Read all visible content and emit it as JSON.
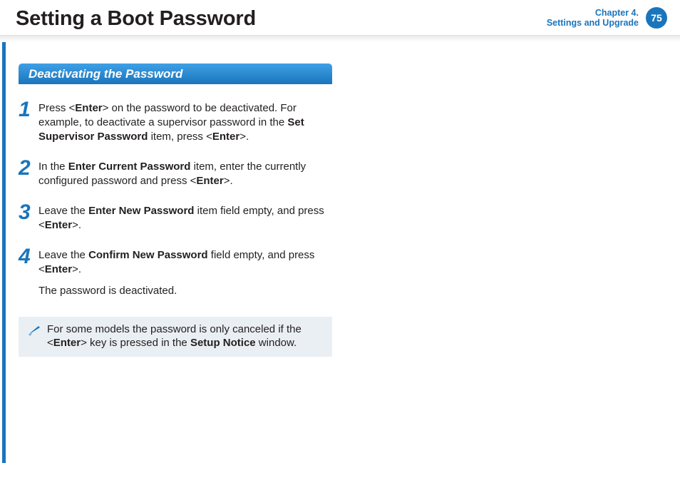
{
  "header": {
    "title": "Setting a Boot Password",
    "chapter_line1": "Chapter 4.",
    "chapter_line2": "Settings and Upgrade",
    "page_number": "75"
  },
  "section": {
    "heading": "Deactivating the Password"
  },
  "steps": [
    {
      "num": "1",
      "html": "Press <<b>Enter</b>> on the password to be deactivated. For example, to deactivate a supervisor password in the <b>Set Supervisor Password</b> item, press <<b>Enter</b>>."
    },
    {
      "num": "2",
      "html": "In the <b>Enter Current Password</b> item, enter the currently configured password and press <<b>Enter</b>>."
    },
    {
      "num": "3",
      "html": "Leave the <b>Enter New Password</b> item field empty, and press <<b>Enter</b>>."
    },
    {
      "num": "4",
      "html": "Leave the <b>Confirm New Password</b> field empty, and press <<b>Enter</b>>."
    }
  ],
  "followup": "The password is deactivated.",
  "note": {
    "html": "For some models the password is only canceled if the <<b>Enter</b>> key is pressed in the <b>Setup Notice</b> window."
  }
}
